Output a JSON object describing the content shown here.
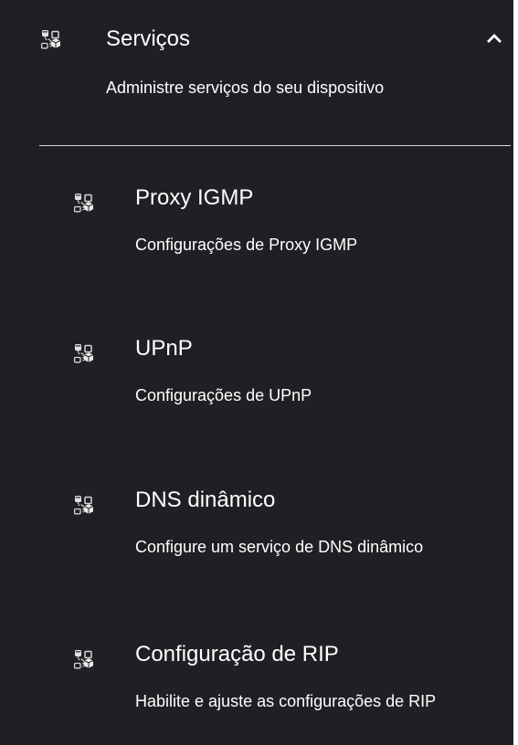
{
  "section": {
    "icon": "services-icon",
    "title": "Serviços",
    "description": "Administre serviços do seu dispositivo",
    "expanded": true,
    "toggle_icon": "chevron-up-icon"
  },
  "items": [
    {
      "icon": "services-icon",
      "title": "Proxy IGMP",
      "description": "Configurações de Proxy IGMP"
    },
    {
      "icon": "services-icon",
      "title": "UPnP",
      "description": "Configurações de UPnP"
    },
    {
      "icon": "services-icon",
      "title": "DNS dinâmico",
      "description": "Configure um serviço de DNS dinâmico"
    },
    {
      "icon": "services-icon",
      "title": "Configuração de RIP",
      "description": "Habilite e ajuste as configurações de RIP"
    }
  ],
  "colors": {
    "panel_background": "#1f2024",
    "text": "#ffffff",
    "divider": "#d9d9d9",
    "page_background": "#ffffff"
  }
}
